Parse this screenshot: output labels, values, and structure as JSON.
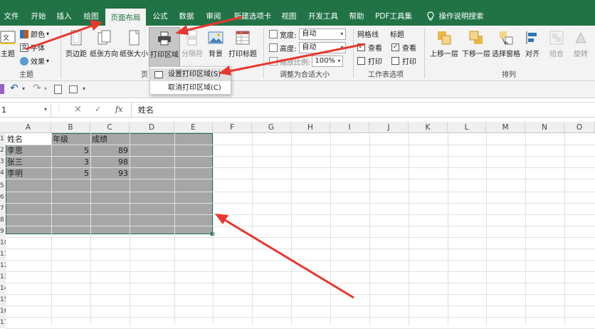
{
  "tabs": [
    "文件",
    "开始",
    "插入",
    "绘图",
    "页面布局",
    "公式",
    "数据",
    "审阅",
    "新建选项卡",
    "视图",
    "开发工具",
    "帮助",
    "PDF工具集",
    "操作说明搜索"
  ],
  "ribbon": {
    "theme": {
      "label": "主题",
      "colors": "颜色",
      "fonts": "字体",
      "effects": "效果",
      "group": "主题"
    },
    "page_setup": {
      "margins": "页边距",
      "orientation": "纸张方向",
      "size": "纸张大小",
      "print_area": "打印区域",
      "breaks": "分隔符",
      "background": "背景",
      "print_titles": "打印标题",
      "group": "页"
    },
    "scale": {
      "width_label": "宽度:",
      "width_value": "自动",
      "height_label": "高度:",
      "height_value": "自动",
      "scale_label": "缩放比例:",
      "scale_value": "100%",
      "group": "调整为合适大小"
    },
    "sheet_options": {
      "gridlines": "网格线",
      "headings": "标题",
      "view": "查看",
      "print": "打印",
      "group": "工作表选项"
    },
    "arrange": {
      "bring_forward": "上移一层",
      "send_backward": "下移一层",
      "selection_pane": "选择窗格",
      "align": "对齐",
      "group_btn": "组合",
      "rotate": "旋转",
      "group": "排列"
    }
  },
  "print_area_menu": {
    "set": "设置打印区域(S)",
    "clear": "取消打印区域(C)"
  },
  "formula_bar": {
    "name_box": "1",
    "cancel": "×",
    "enter": "✓",
    "fx": "fx",
    "content": "姓名"
  },
  "columns": [
    "A",
    "B",
    "C",
    "D",
    "E",
    "F",
    "G",
    "H",
    "I",
    "J",
    "K",
    "L",
    "M",
    "N",
    "O"
  ],
  "rows": [
    "1",
    "2",
    "3",
    "4",
    "5",
    "6",
    "7",
    "8",
    "9",
    "10",
    "11",
    "12",
    "13",
    "14",
    "15",
    "16",
    "17"
  ],
  "cells": {
    "A1": "姓名",
    "B1": "年级",
    "C1": "成绩",
    "A2": "李思",
    "B2": "5",
    "C2": "89",
    "A3": "张三",
    "B3": "3",
    "C3": "98",
    "A4": "李明",
    "B4": "5",
    "C4": "93"
  },
  "colors": {
    "excel_green": "#217346",
    "selection": "#a6a6a6",
    "arrow": "#e8372e"
  }
}
